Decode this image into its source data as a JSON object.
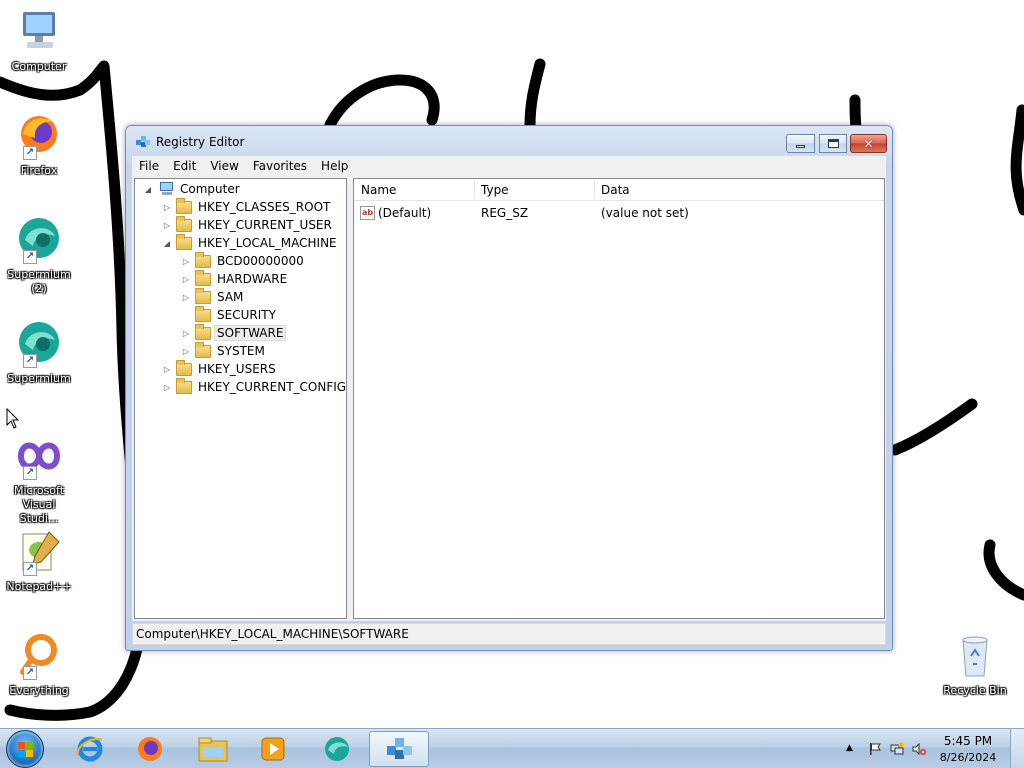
{
  "desktop": {
    "icons": [
      {
        "label": "Computer",
        "icon": "computer-icon"
      },
      {
        "label": "Firefox",
        "icon": "firefox-icon"
      },
      {
        "label": "Supermium (2)",
        "icon": "supermium-icon"
      },
      {
        "label": "Supermium",
        "icon": "supermium-icon"
      },
      {
        "label": "Microsoft Visual Studi...",
        "icon": "visual-studio-icon"
      },
      {
        "label": "Notepad++",
        "icon": "notepadpp-icon"
      },
      {
        "label": "Everything",
        "icon": "everything-icon"
      },
      {
        "label": "Recycle Bin",
        "icon": "recycle-bin-icon"
      }
    ]
  },
  "window": {
    "title": "Registry Editor",
    "close_glyph": "✕",
    "menu": [
      "File",
      "Edit",
      "View",
      "Favorites",
      "Help"
    ],
    "tree": {
      "root": "Computer",
      "hives": [
        {
          "label": "HKEY_CLASSES_ROOT",
          "expander": "▷"
        },
        {
          "label": "HKEY_CURRENT_USER",
          "expander": "▷"
        },
        {
          "label": "HKEY_LOCAL_MACHINE",
          "expander": "◢"
        },
        {
          "label": "HKEY_USERS",
          "expander": "▷"
        },
        {
          "label": "HKEY_CURRENT_CONFIG",
          "expander": "▷"
        }
      ],
      "hklm_children": [
        {
          "label": "BCD00000000",
          "expander": "▷"
        },
        {
          "label": "HARDWARE",
          "expander": "▷"
        },
        {
          "label": "SAM",
          "expander": "▷"
        },
        {
          "label": "SECURITY",
          "expander": ""
        },
        {
          "label": "SOFTWARE",
          "expander": "▷",
          "selected": true
        },
        {
          "label": "SYSTEM",
          "expander": "▷"
        }
      ],
      "root_expander": "◢"
    },
    "list": {
      "columns": [
        "Name",
        "Type",
        "Data"
      ],
      "rows": [
        {
          "name": "(Default)",
          "type": "REG_SZ",
          "data": "(value not set)",
          "icon": "string-value-icon",
          "icon_text": "ab"
        }
      ]
    },
    "status": "Computer\\HKEY_LOCAL_MACHINE\\SOFTWARE"
  },
  "taskbar": {
    "pinned": [
      "internet-explorer-icon",
      "firefox-icon",
      "file-explorer-icon",
      "media-player-icon",
      "supermium-icon",
      "regedit-icon"
    ],
    "active": "regedit-icon",
    "tray": {
      "overflow_glyph": "▲",
      "icons": [
        "action-center-flag-icon",
        "network-icon",
        "volume-muted-icon"
      ],
      "time": "5:45 PM",
      "date": "8/26/2024"
    }
  },
  "colors": {
    "window_frame": "#c5d6ec",
    "taskbar": "#bcd1e6",
    "close_button": "#c4402c",
    "doodle_stroke": "#000000"
  }
}
